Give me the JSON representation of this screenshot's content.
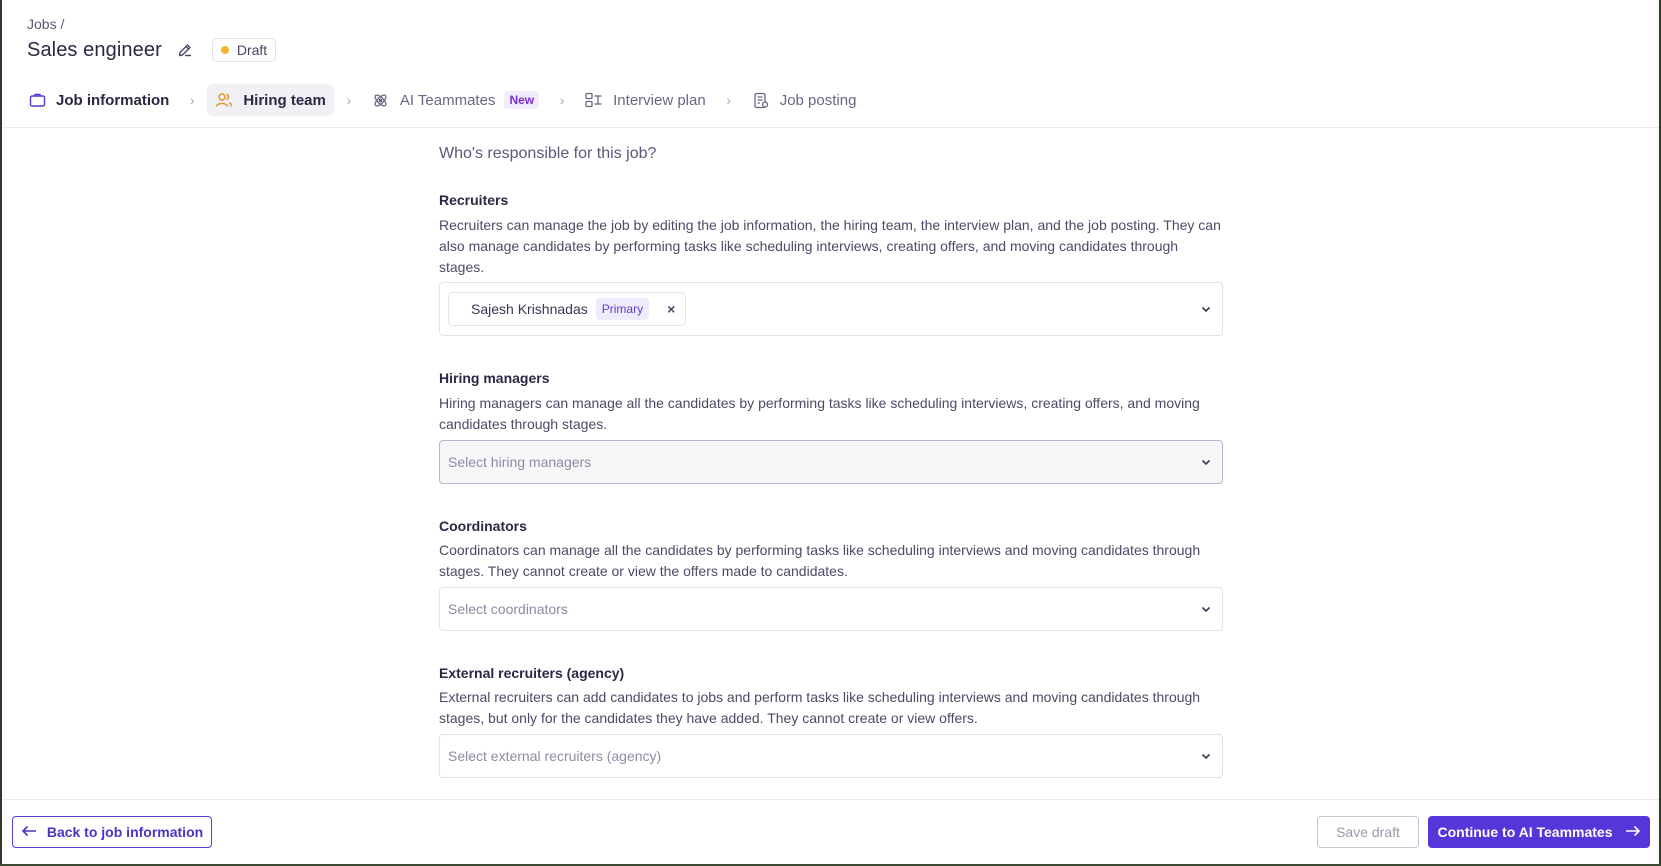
{
  "breadcrumb": "Jobs /",
  "title": "Sales engineer",
  "status": "Draft",
  "steps": [
    {
      "label": "Job information",
      "icon": "briefcase-icon"
    },
    {
      "label": "Hiring team",
      "icon": "users-icon"
    },
    {
      "label": "AI Teammates",
      "icon": "atom-icon",
      "badge": "New"
    },
    {
      "label": "Interview plan",
      "icon": "flow-icon"
    },
    {
      "label": "Job posting",
      "icon": "document-icon"
    }
  ],
  "question": "Who's responsible for this job?",
  "sections": {
    "recruiters": {
      "label": "Recruiters",
      "description": "Recruiters can manage the job by editing the job information, the hiring team, the interview plan, and the job posting. They can also manage candidates by performing tasks like scheduling interviews, creating offers, and moving candidates through stages.",
      "chip_name": "Sajesh Krishnadas",
      "chip_tag": "Primary",
      "chip_remove": "×"
    },
    "hiring_managers": {
      "label": "Hiring managers",
      "description": "Hiring managers can manage all the candidates by performing tasks like scheduling interviews, creating offers, and moving candidates through stages.",
      "placeholder": "Select hiring managers"
    },
    "coordinators": {
      "label": "Coordinators",
      "description": "Coordinators can manage all the candidates by performing tasks like scheduling interviews and moving candidates through stages. They cannot create or view the offers made to candidates.",
      "placeholder": "Select coordinators"
    },
    "external": {
      "label": "External recruiters (agency)",
      "description": "External recruiters can add candidates to jobs and perform tasks like scheduling interviews and moving candidates through stages, but only for the candidates they have added. They cannot create or view offers.",
      "placeholder": "Select external recruiters (agency)"
    }
  },
  "footer": {
    "back_label": "Back to job information",
    "save_label": "Save draft",
    "continue_label": "Continue to AI Teammates"
  },
  "colors": {
    "accent": "#5636d9",
    "draft_dot": "#f5b52e",
    "new_badge": "#7a2fd1"
  }
}
